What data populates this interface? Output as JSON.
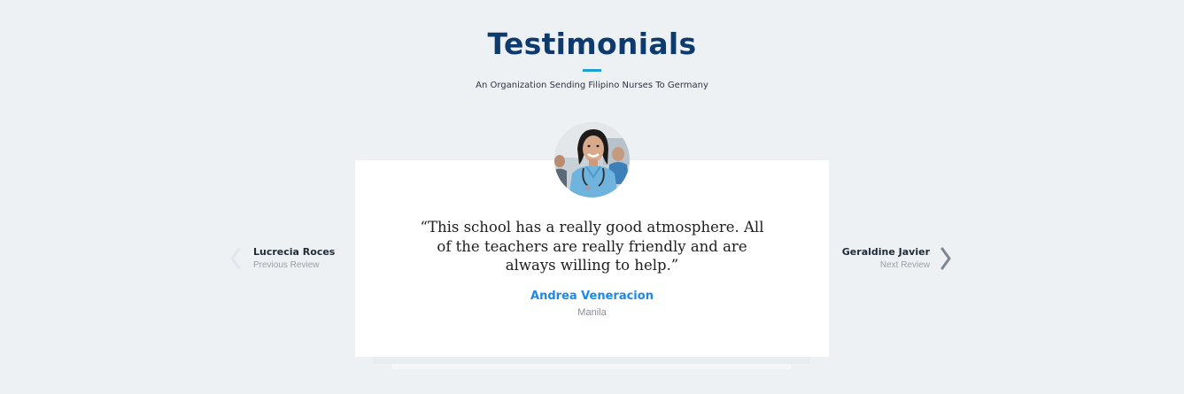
{
  "header": {
    "title": "Testimonials",
    "subtitle": "An Organization Sending Filipino Nurses To Germany"
  },
  "testimonial": {
    "quote": "“This school has a really good atmosphere. All of the teachers are really friendly and are always willing to help.”",
    "author": "Andrea Veneracion",
    "location": "Manila",
    "avatar_icon": "nurse-photo"
  },
  "navigation": {
    "previous": {
      "name": "Lucrecia Roces",
      "label": "Previous Review",
      "icon": "chevron-left-icon"
    },
    "next": {
      "name": "Geraldine Javier",
      "label": "Next Review",
      "icon": "chevron-right-icon"
    }
  },
  "colors": {
    "background": "#eef1f4",
    "title": "#0e3a6e",
    "accent": "#1ea0d6",
    "author": "#1e88e5"
  }
}
